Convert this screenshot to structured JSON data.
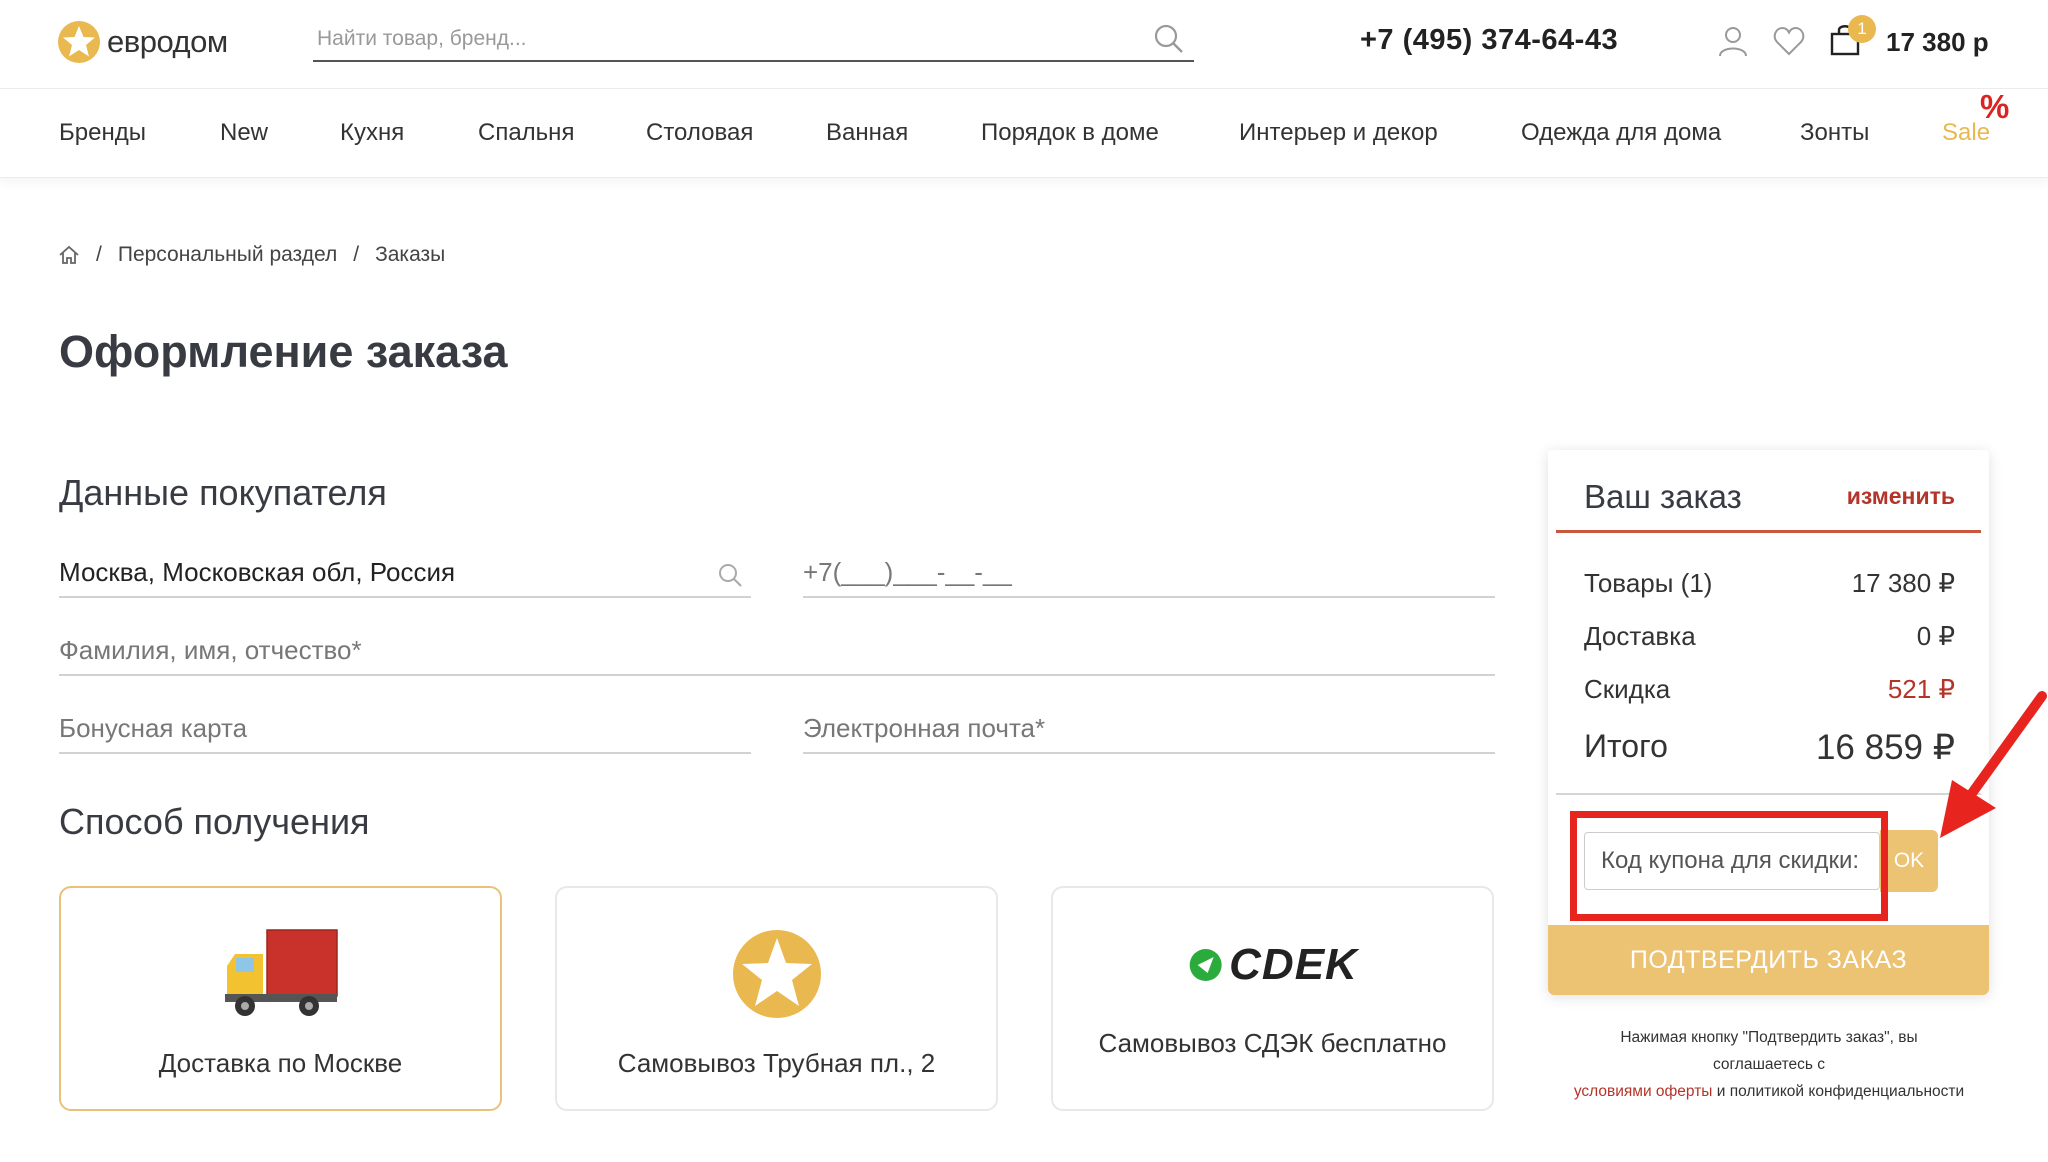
{
  "header": {
    "logo_text": "евродом",
    "search_placeholder": "Найти товар, бренд...",
    "phone": "+7 (495) 374-64-43",
    "cart_count": "1",
    "cart_sum": "17 380 р"
  },
  "nav": {
    "items": [
      "Бренды",
      "New",
      "Кухня",
      "Спальня",
      "Столовая",
      "Ванная",
      "Порядок в доме",
      "Интерьер и декор",
      "Одежда для дома",
      "Зонты",
      "Sale"
    ],
    "sale_badge": "%"
  },
  "breadcrumb": {
    "items": [
      "Персональный раздел",
      "Заказы"
    ],
    "separator": "/"
  },
  "page": {
    "title": "Оформление заказа"
  },
  "buyer": {
    "title": "Данные покупателя",
    "city_value": "Москва, Московская обл, Россия",
    "phone_placeholder": "+7(___)___-__-__",
    "name_placeholder": "Фамилия, имя, отчество*",
    "bonus_placeholder": "Бонусная карта",
    "email_placeholder": "Электронная почта*"
  },
  "delivery": {
    "title": "Способ получения",
    "options": [
      {
        "label": "Доставка по Москве",
        "selected": true,
        "icon": "truck-icon"
      },
      {
        "label": "Самовывоз Трубная пл., 2",
        "selected": false,
        "icon": "star-logo-icon"
      },
      {
        "label": "Самовывоз СДЭК бесплатно",
        "selected": false,
        "icon": "cdek-logo"
      }
    ],
    "cdek_logo_text": "СDEK"
  },
  "summary": {
    "title": "Ваш заказ",
    "edit_label": "изменить",
    "rows": [
      {
        "label": "Товары (1)",
        "value": "17 380 ₽"
      },
      {
        "label": "Доставка",
        "value": "0 ₽"
      },
      {
        "label": "Скидка",
        "value": "521 ₽"
      }
    ],
    "total_label": "Итого",
    "total_value": "16 859 ₽",
    "coupon_placeholder": "Код купона для скидки:",
    "ok_label": "OK",
    "confirm_label": "ПОДТВЕРДИТЬ ЗАКАЗ"
  },
  "legal": {
    "line1": "Нажимая кнопку \"Подтвердить заказ\", вы",
    "line2": "соглашаетесь с",
    "link_text": "условиями оферты",
    "line3_rest": " и политикой конфиденциальности"
  },
  "colors": {
    "accent": "#ecc273",
    "brand_red": "#b5342a",
    "annotation_red": "#e8241f"
  }
}
